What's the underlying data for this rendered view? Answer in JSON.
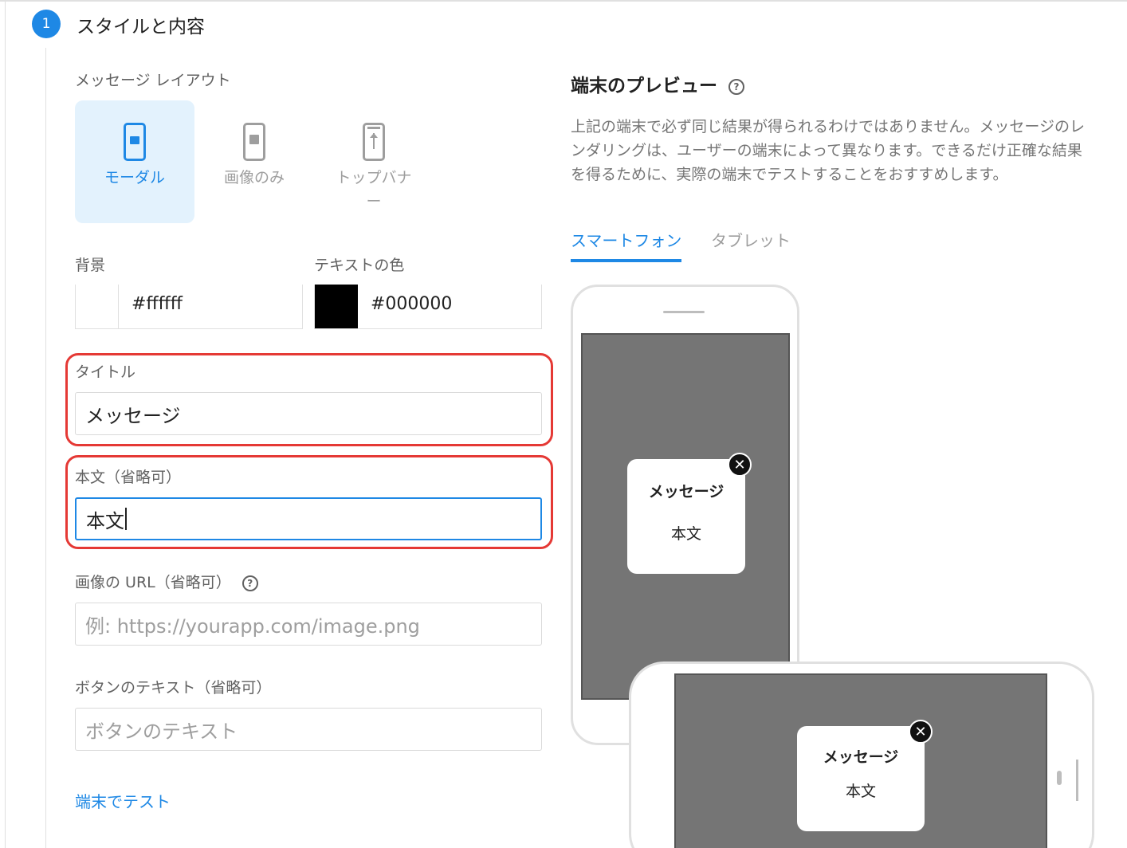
{
  "step": {
    "number": "1",
    "title": "スタイルと内容"
  },
  "layout_section": {
    "label": "メッセージ レイアウト",
    "options": [
      {
        "label": "モーダル",
        "selected": true
      },
      {
        "label": "画像のみ",
        "selected": false
      },
      {
        "label": "トップバナー",
        "selected": false
      }
    ]
  },
  "background": {
    "label": "背景",
    "value": "#ffffff",
    "swatch": "#ffffff"
  },
  "text_color": {
    "label": "テキストの色",
    "value": "#000000",
    "swatch": "#000000"
  },
  "title_field": {
    "label": "タイトル",
    "value": "メッセージ"
  },
  "body_field": {
    "label": "本文（省略可）",
    "value": "本文"
  },
  "image_url_field": {
    "label": "画像の URL（省略可）",
    "placeholder": "例: https://yourapp.com/image.png"
  },
  "button_text_field": {
    "label": "ボタンのテキスト（省略可）",
    "placeholder": "ボタンのテキスト"
  },
  "test_link": "端末でテスト",
  "preview": {
    "title": "端末のプレビュー",
    "description": "上記の端末で必ず同じ結果が得られるわけではありません。メッセージのレンダリングは、ユーザーの端末によって異なります。できるだけ正確な結果を得るために、実際の端末でテストすることをおすすめします。",
    "tabs": [
      {
        "label": "スマートフォン",
        "active": true
      },
      {
        "label": "タブレット",
        "active": false
      }
    ],
    "modal_title": "メッセージ",
    "modal_body": "本文"
  },
  "colors": {
    "accent": "#1e88e5",
    "highlight": "#e53935",
    "selected_bg": "#e3f2fd",
    "screen": "#757575"
  }
}
